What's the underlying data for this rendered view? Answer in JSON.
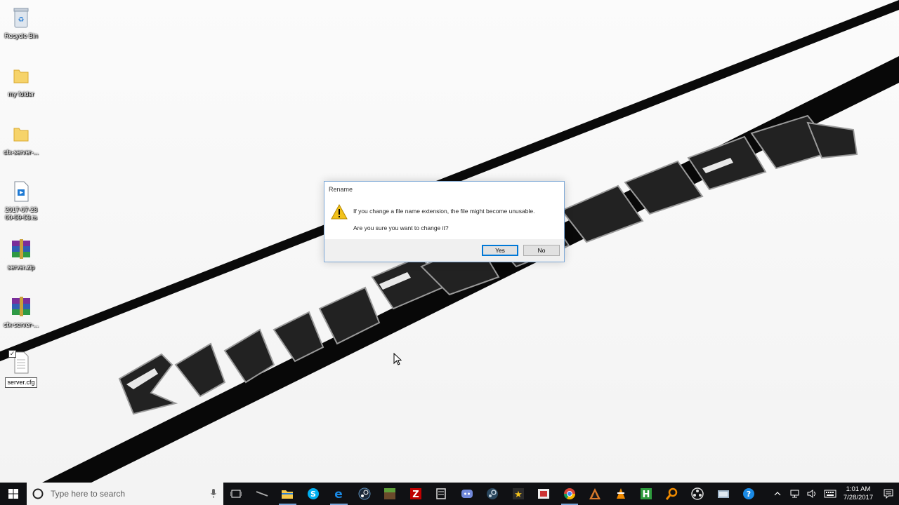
{
  "desktop": {
    "icons": [
      {
        "label": "Recycle Bin"
      },
      {
        "label": "my folder"
      },
      {
        "label": "cfx-server-..."
      },
      {
        "label": "2017-07-28 00-59-53.ts"
      },
      {
        "label": "server.zip"
      },
      {
        "label": "cfx-server-..."
      },
      {
        "label": "server.cfg"
      }
    ]
  },
  "dialog": {
    "title": "Rename",
    "message": "If you change a file name extension, the file might become unusable.",
    "question": "Are you sure you want to change it?",
    "yes_label": "Yes",
    "no_label": "No"
  },
  "taskbar": {
    "search_placeholder": "Type here to search",
    "apps": [
      "file-explorer",
      "skype",
      "edge",
      "steam-client",
      "minecraft",
      "filezilla",
      "app-window",
      "discord",
      "steam",
      "star-app",
      "game-app",
      "chrome",
      "ascension",
      "vlc",
      "hamachi",
      "search-app",
      "obs",
      "network-folder",
      "help"
    ],
    "clock_time": "1:01 AM",
    "clock_date": "7/28/2017"
  },
  "colors": {
    "accent": "#0078d7",
    "taskbar_bg": "#101114",
    "dialog_border": "#7ea8d6"
  }
}
